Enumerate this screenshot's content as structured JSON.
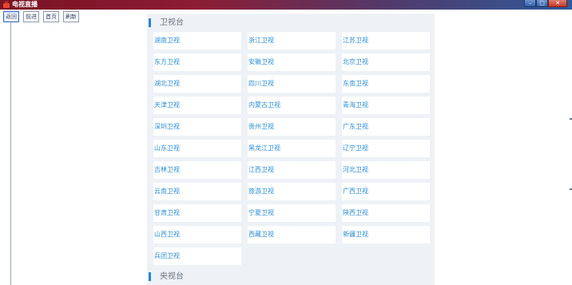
{
  "window": {
    "title": "电视直播"
  },
  "toolbar": {
    "buttons": [
      {
        "label": "返回"
      },
      {
        "label": "前进"
      },
      {
        "label": "首页"
      },
      {
        "label": "刷新"
      }
    ]
  },
  "sections": [
    {
      "title": "卫视台",
      "channels": [
        "湖南卫视",
        "浙江卫视",
        "江苏卫视",
        "东方卫视",
        "安徽卫视",
        "北京卫视",
        "湖北卫视",
        "四川卫视",
        "东南卫视",
        "天津卫视",
        "内蒙古卫视",
        "青海卫视",
        "深圳卫视",
        "贵州卫视",
        "广东卫视",
        "山东卫视",
        "黑龙江卫视",
        "辽宁卫视",
        "吉林卫视",
        "江西卫视",
        "河北卫视",
        "云南卫视",
        "旅游卫视",
        "广西卫视",
        "甘肃卫视",
        "宁夏卫视",
        "陕西卫视",
        "山西卫视",
        "西藏卫视",
        "新疆卫视",
        "兵团卫视"
      ]
    },
    {
      "title": "央视台",
      "channels": []
    }
  ],
  "colors": {
    "accent": "#2585d6",
    "channel_text": "#2d8fd6",
    "panel_bg": "#eef2f6"
  }
}
